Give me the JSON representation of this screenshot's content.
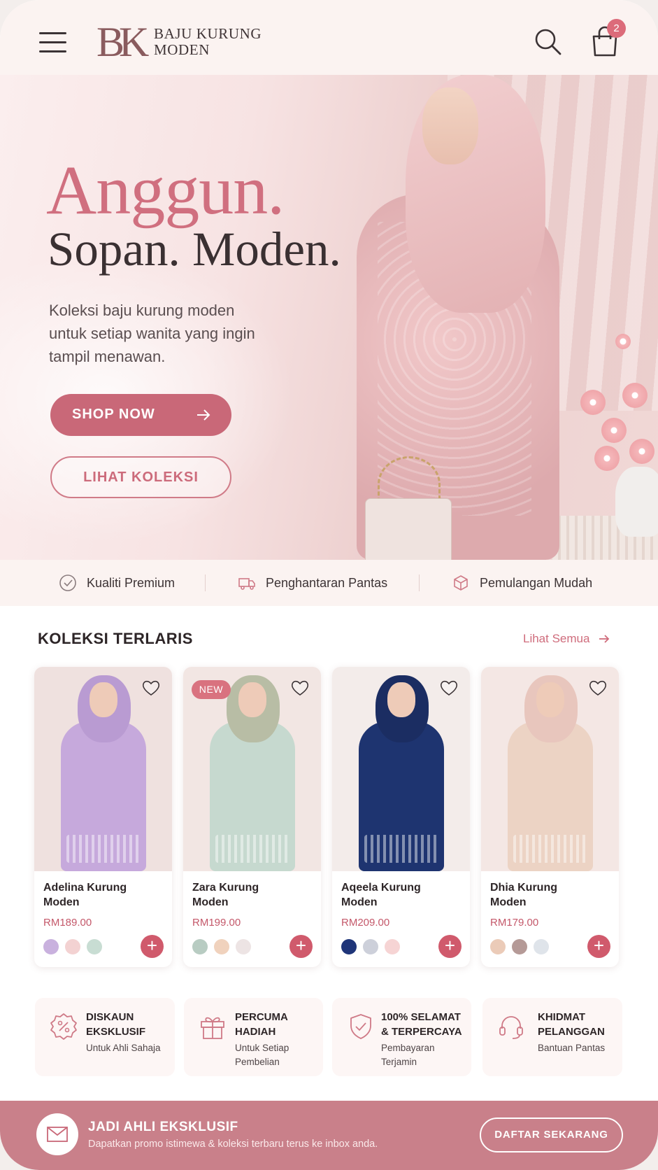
{
  "header": {
    "logo_mark": "BK",
    "brand_line1": "BAJU KURUNG",
    "brand_line2": "MODEN",
    "cart_count": "2"
  },
  "hero": {
    "title_line1": "Anggun.",
    "title_line2": "Sopan. Moden.",
    "description": "Koleksi baju kurung moden untuk setiap wanita yang ingin tampil menawan.",
    "primary_cta": "SHOP NOW",
    "secondary_cta": "LIHAT KOLEKSI"
  },
  "features": [
    {
      "icon": "check-circle-icon",
      "label": "Kualiti Premium"
    },
    {
      "icon": "truck-icon",
      "label": "Penghantaran Pantas"
    },
    {
      "icon": "box-icon",
      "label": "Pemulangan Mudah"
    }
  ],
  "bestsellers": {
    "title": "KOLEKSI TERLARIS",
    "see_all": "Lihat Semua",
    "products": [
      {
        "name": "Adelina Kurung Moden",
        "price": "RM189.00",
        "badge": "",
        "outfit_color": "#c6a9dc",
        "hijab_color": "#b99bd2",
        "bg": "#efe1df",
        "swatches": [
          "#c9b1de",
          "#f3d2d2",
          "#c8ddd3"
        ]
      },
      {
        "name": "Zara Kurung Moden",
        "price": "RM199.00",
        "badge": "NEW",
        "outfit_color": "#c6d9cf",
        "hijab_color": "#b8bda5",
        "bg": "#f2e6e3",
        "swatches": [
          "#b8ccc2",
          "#f0d2bd",
          "#ede4e4"
        ]
      },
      {
        "name": "Aqeela Kurung Moden",
        "price": "RM209.00",
        "badge": "",
        "outfit_color": "#1e3470",
        "hijab_color": "#1b2d62",
        "bg": "#f3ecea",
        "swatches": [
          "#1f3579",
          "#cdd0da",
          "#f6d4d4"
        ]
      },
      {
        "name": "Dhia Kurung Moden",
        "price": "RM179.00",
        "badge": "",
        "outfit_color": "#ecd3c4",
        "hijab_color": "#e8c6bd",
        "bg": "#f4e7e4",
        "swatches": [
          "#ebcbb8",
          "#b59a97",
          "#dfe4ea"
        ]
      }
    ]
  },
  "benefits": [
    {
      "icon": "discount-badge-icon",
      "title": "DISKAUN EKSKLUSIF",
      "subtitle": "Untuk Ahli Sahaja"
    },
    {
      "icon": "gift-icon",
      "title": "PERCUMA HADIAH",
      "subtitle": "Untuk Setiap Pembelian"
    },
    {
      "icon": "shield-check-icon",
      "title": "100% SELAMAT & TERPERCAYA",
      "subtitle": "Pembayaran Terjamin"
    },
    {
      "icon": "headset-icon",
      "title": "KHIDMAT PELANGGAN",
      "subtitle": "Bantuan Pantas"
    }
  ],
  "newsletter": {
    "title": "JADI AHLI EKSKLUSIF",
    "subtitle": "Dapatkan promo istimewa & koleksi terbaru terus ke inbox anda.",
    "cta": "DAFTAR SEKARANG"
  },
  "colors": {
    "accent": "#c96878",
    "accent_dark": "#d05a6c",
    "footer": "#c9808a",
    "header_bg": "#fbf3f1"
  }
}
